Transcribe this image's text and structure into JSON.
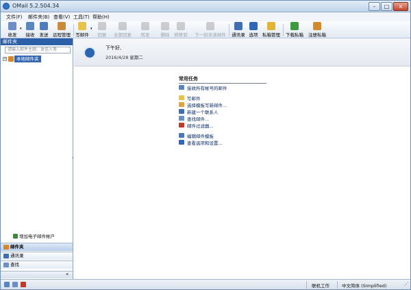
{
  "window": {
    "title": "OMail 5.2.504.34"
  },
  "title_buttons": {
    "minimize": "–",
    "maximize": "□",
    "close": "×"
  },
  "menu": [
    "文件(F)",
    "邮件夹(B)",
    "查看(V)",
    "工具(T)",
    "帮助(H)"
  ],
  "toolbar": [
    {
      "label": "收发",
      "icon": "send-receive-icon",
      "enabled": true
    },
    {
      "label": "接收",
      "icon": "receive-icon",
      "enabled": true
    },
    {
      "label": "发送",
      "icon": "send-icon",
      "enabled": true
    },
    {
      "label": "远程管理",
      "icon": "remote-manage-icon",
      "enabled": true
    },
    {
      "label": "写邮件",
      "icon": "compose-icon",
      "enabled": true
    },
    {
      "label": "回复",
      "icon": "reply-icon",
      "enabled": false
    },
    {
      "label": "全部回复",
      "icon": "reply-all-icon",
      "enabled": false
    },
    {
      "label": "转发",
      "icon": "forward-icon",
      "enabled": false
    },
    {
      "label": "删除",
      "icon": "delete-icon",
      "enabled": false
    },
    {
      "label": "转移到",
      "icon": "move-to-icon",
      "enabled": false
    },
    {
      "label": "下一封未读邮件",
      "icon": "next-unread-icon",
      "enabled": false
    },
    {
      "label": "通讯录",
      "icon": "address-book-icon",
      "enabled": true
    },
    {
      "label": "选项",
      "icon": "options-icon",
      "enabled": true
    },
    {
      "label": "私箱管理",
      "icon": "private-box-icon",
      "enabled": true
    },
    {
      "label": "下载私箱",
      "icon": "download-private-icon",
      "enabled": true
    },
    {
      "label": "注册私箱",
      "icon": "register-private-icon",
      "enabled": true
    }
  ],
  "left_pane": {
    "header": "邮件夹",
    "search_placeholder": "请输入邮件主题、发信人等",
    "tree_toggle": "+",
    "tree_node": "本地邮件夹",
    "add_account": "增加电子邮件帐户",
    "nav": [
      {
        "label": "邮件夹",
        "active": true
      },
      {
        "label": "通讯录",
        "active": false
      },
      {
        "label": "查找",
        "active": false
      }
    ],
    "collapse_glyph": "«",
    "splitter_glyph": "‹"
  },
  "welcome": {
    "greeting": "下午好,",
    "date": "2016/4/28 星期二"
  },
  "tasks": {
    "heading": "常用任务",
    "items": [
      "接收所有帐号的邮件",
      "写邮件",
      "选择模板写新邮件...",
      "新建一个联系人",
      "查找邮件...",
      "邮件过滤器...",
      "编辑邮件模板",
      "查看选项和设置..."
    ]
  },
  "status": {
    "mode": "联机工作",
    "language": "中文简体 (Simplified)",
    "grip": "⋰"
  },
  "colors": {
    "accent": "#2b5fa7",
    "title_gradient_top": "#e3ecf7",
    "close_button": "#c3452d"
  }
}
